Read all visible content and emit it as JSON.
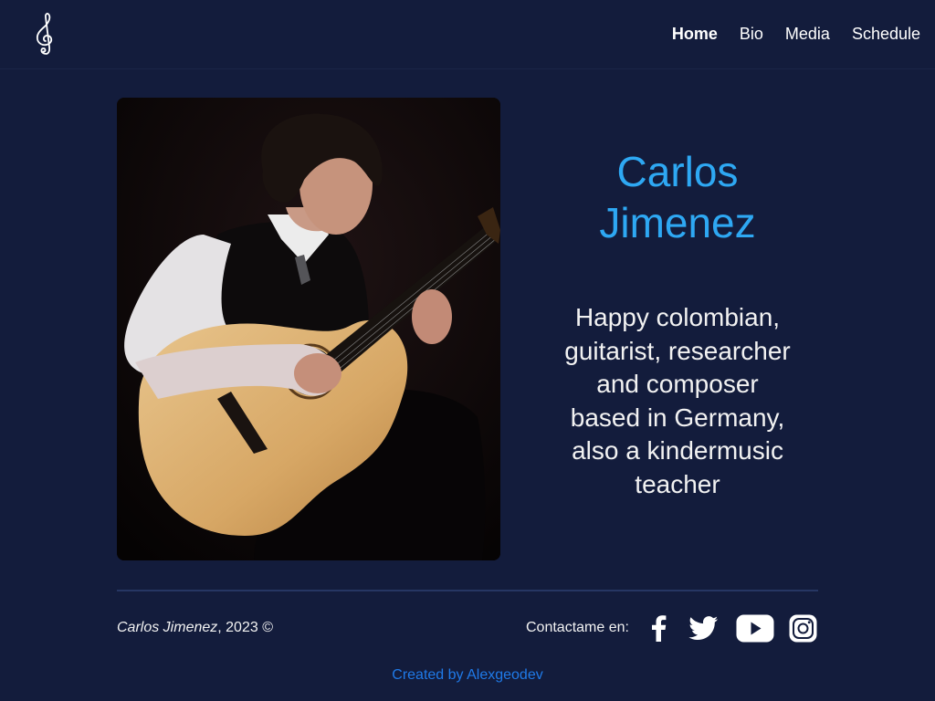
{
  "header": {
    "logo_icon": "treble-clef-icon",
    "nav": [
      {
        "label": "Home",
        "active": true
      },
      {
        "label": "Bio",
        "active": false
      },
      {
        "label": "Media",
        "active": false
      },
      {
        "label": "Schedule",
        "active": false
      }
    ]
  },
  "hero": {
    "photo_icon": "guitarist-photo",
    "name": "Carlos Jimenez",
    "tagline": "Happy colombian, guitarist, researcher and composer based in Germany, also a kindermusic teacher"
  },
  "footer": {
    "copyright_name": "Carlos Jimenez",
    "copyright_rest": ", 2023 ©",
    "contact_label": "Contactame en:",
    "social": [
      {
        "icon": "facebook-icon"
      },
      {
        "icon": "twitter-icon"
      },
      {
        "icon": "youtube-icon"
      },
      {
        "icon": "instagram-icon"
      }
    ],
    "credit": "Created by Alexgeodev"
  },
  "colors": {
    "background": "#131c3c",
    "accent": "#2ea8f3",
    "link": "#1f7ae8",
    "divider": "#263663"
  }
}
